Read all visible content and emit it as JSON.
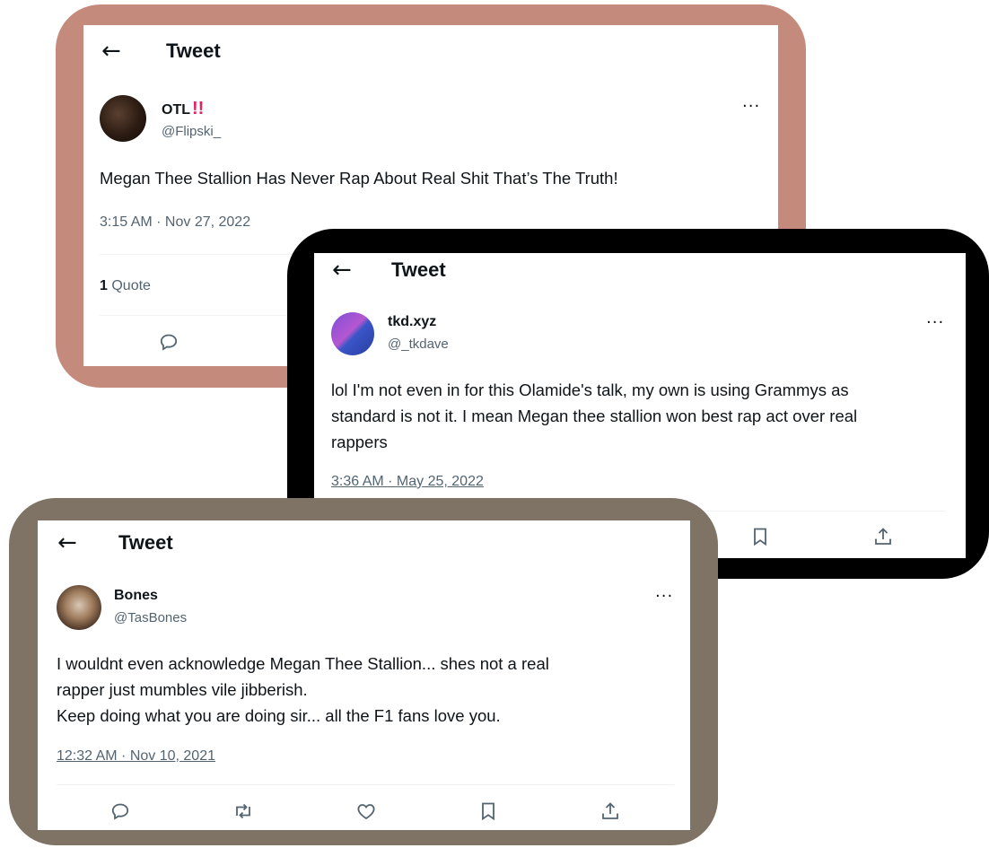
{
  "tweets": [
    {
      "header_title": "Tweet",
      "display_name": "OTL",
      "badge": "!!",
      "handle": "@Flipski_",
      "text": "Megan Thee Stallion Has Never Rap About Real Shit That’s The Truth!",
      "timestamp": "3:15 AM · Nov 27, 2022",
      "quote_count": "1",
      "quote_label": "Quote"
    },
    {
      "header_title": "Tweet",
      "display_name": "tkd.xyz",
      "handle": "@_tkdave",
      "text_lines": [
        "lol I'm not even in for this Olamide's talk, my own is using Grammys as",
        "standard is not it. I mean Megan thee stallion won best rap act over real",
        "rappers"
      ],
      "timestamp": "3:36 AM · May 25, 2022"
    },
    {
      "header_title": "Tweet",
      "display_name": "Bones",
      "handle": "@TasBones",
      "text_lines": [
        "I wouldnt even acknowledge Megan Thee Stallion... shes not a real",
        "rapper just mumbles vile jibberish.",
        "Keep doing what you are doing sir... all the F1 fans love you."
      ],
      "timestamp": "12:32 AM · Nov 10, 2021"
    }
  ],
  "icons": {
    "back": "←",
    "more": "···",
    "reply": "reply-icon",
    "retweet": "retweet-icon",
    "like": "like-icon",
    "bookmark": "bookmark-icon",
    "share": "share-icon"
  },
  "colors": {
    "frame_1": "#c48b7d",
    "frame_2": "#000000",
    "frame_3": "#7e7365",
    "badge": "#e0245e",
    "muted_text": "#536471"
  }
}
